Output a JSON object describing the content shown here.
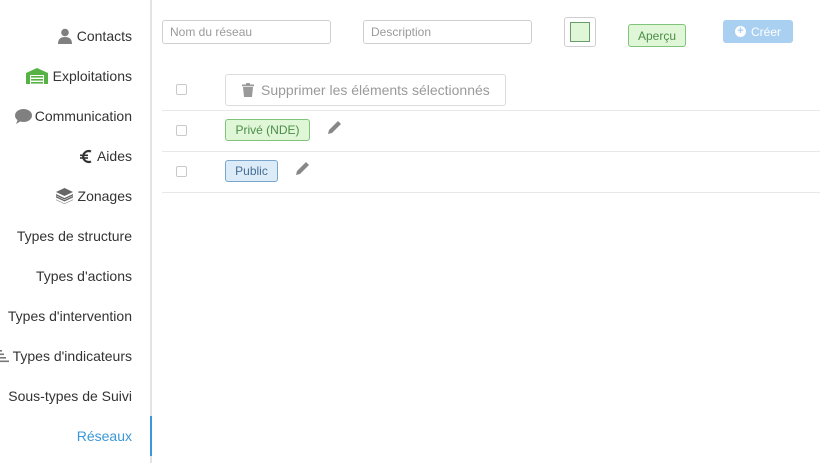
{
  "sidebar": {
    "items": [
      {
        "label": "Contacts",
        "icon": "person-icon"
      },
      {
        "label": "Exploitations",
        "icon": "warehouse-icon"
      },
      {
        "label": "Communication",
        "icon": "speech-bubble-icon"
      },
      {
        "label": "Aides",
        "icon": "euro-icon"
      },
      {
        "label": "Zonages",
        "icon": "layers-icon"
      },
      {
        "label": "Types de structure"
      },
      {
        "label": "Types d'actions"
      },
      {
        "label": "Types d'intervention"
      },
      {
        "label": "Types d'indicateurs",
        "icon": "sort-icon"
      },
      {
        "label": "Sous-types de Suivi"
      },
      {
        "label": "Réseaux",
        "active": true
      }
    ],
    "active_color": "#3a98d8"
  },
  "form": {
    "name_placeholder": "Nom du réseau",
    "name_value": "",
    "description_placeholder": "Description",
    "description_value": "",
    "swatch_color": "#dff7d7",
    "preview_label": "Aperçu",
    "create_label": "Créer"
  },
  "table": {
    "delete_selected_label": "Supprimer les éléments sélectionnés",
    "rows": [
      {
        "label": "Privé (NDE)",
        "color": "green"
      },
      {
        "label": "Public",
        "color": "blue"
      }
    ]
  }
}
